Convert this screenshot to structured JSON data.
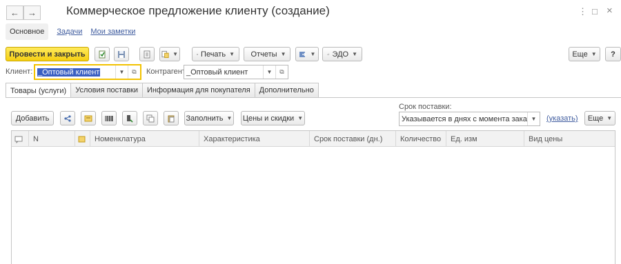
{
  "window": {
    "title": "Коммерческое предложение клиенту (создание)",
    "back_glyph": "←",
    "forward_glyph": "→",
    "menu_glyph": "⋮",
    "restore_glyph": "□",
    "close_glyph": "×"
  },
  "subnav": {
    "main": "Основное",
    "tasks": "Задачи",
    "notes": "Мои заметки"
  },
  "toolbar": {
    "post_close": "Провести и закрыть",
    "print": "Печать",
    "reports": "Отчеты",
    "edo": "ЭДО",
    "more": "Еще",
    "help": "?"
  },
  "form": {
    "client_label": "Клиент:",
    "client_value": "_Оптовый клиент",
    "counterparty_label": "Контрагент:",
    "counterparty_value": "_Оптовый клиент"
  },
  "tabs": [
    {
      "label": "Товары (услуги)",
      "active": true
    },
    {
      "label": "Условия поставки",
      "active": false
    },
    {
      "label": "Информация для покупателя",
      "active": false
    },
    {
      "label": "Дополнительно",
      "active": false
    }
  ],
  "goods_toolbar": {
    "add": "Добавить",
    "fill": "Заполнить",
    "prices": "Цены и скидки",
    "delivery_label": "Срок поставки:",
    "delivery_value": "Указывается в днях с момента заказа",
    "specify_link": "(указать)",
    "more": "Еще"
  },
  "table": {
    "columns": [
      "N",
      "Номенклатура",
      "Характеристика",
      "Срок поставки (дн.)",
      "Количество",
      "Ед. изм",
      "Вид цены"
    ],
    "rows": []
  },
  "colors": {
    "primary_button": "#f5cf12",
    "link": "#3f5c9f",
    "selection": "#3a5fc2",
    "active_field_border": "#f2c200"
  }
}
